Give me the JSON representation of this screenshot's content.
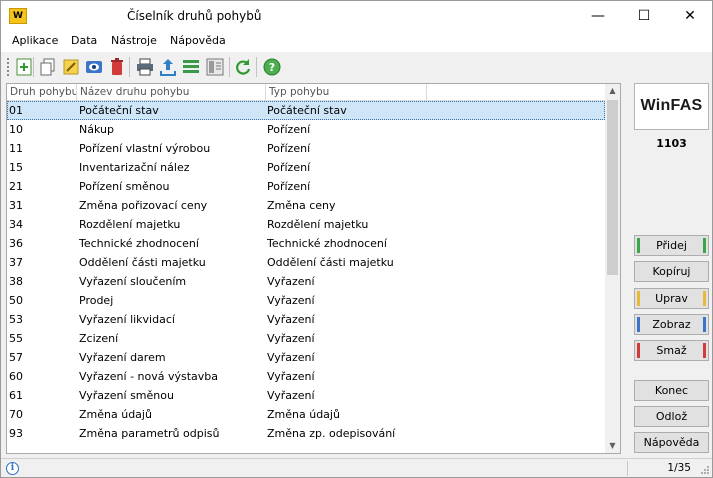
{
  "window": {
    "logo": "W",
    "title": "Číselník druhů pohybů",
    "minimize": "—",
    "maximize": "☐",
    "close": "✕"
  },
  "menu": [
    "Aplikace",
    "Data",
    "Nástroje",
    "Nápověda"
  ],
  "toolbar": {
    "buttons": [
      "add-icon",
      "copy-icon",
      "edit-icon",
      "view-icon",
      "delete-icon",
      "print-icon",
      "export-icon",
      "columns-icon",
      "layout-icon",
      "refresh-icon",
      "help-icon"
    ]
  },
  "grid": {
    "columns": [
      "Druh pohybu",
      "Název druhu pohybu",
      "Typ pohybu"
    ],
    "rows": [
      [
        "01",
        "Počáteční stav",
        "Počáteční stav"
      ],
      [
        "10",
        "Nákup",
        "Pořízení"
      ],
      [
        "11",
        "Pořízení vlastní výrobou",
        "Pořízení"
      ],
      [
        "15",
        "Inventarizační nález",
        "Pořízení"
      ],
      [
        "21",
        "Pořízení směnou",
        "Pořízení"
      ],
      [
        "31",
        "Změna pořizovací ceny",
        "Změna ceny"
      ],
      [
        "34",
        "Rozdělení majetku",
        "Rozdělení majetku"
      ],
      [
        "36",
        "Technické zhodnocení",
        "Technické zhodnocení"
      ],
      [
        "37",
        "Oddělení části majetku",
        "Oddělení části majetku"
      ],
      [
        "38",
        "Vyřazení sloučením",
        "Vyřazení"
      ],
      [
        "50",
        "Prodej",
        "Vyřazení"
      ],
      [
        "53",
        "Vyřazení likvidací",
        "Vyřazení"
      ],
      [
        "55",
        "Zcizení",
        "Vyřazení"
      ],
      [
        "57",
        "Vyřazení darem",
        "Vyřazení"
      ],
      [
        "60",
        "Vyřazení - nová výstavba",
        "Vyřazení"
      ],
      [
        "61",
        "Vyřazení směnou",
        "Vyřazení"
      ],
      [
        "70",
        "Změna údajů",
        "Změna údajů"
      ],
      [
        "93",
        "Změna parametrů odpisů",
        "Změna zp. odepisování"
      ]
    ],
    "selected_row": 0
  },
  "side": {
    "logo": "WinFAS",
    "company_code": "1103",
    "buttons": {
      "add": "Přidej",
      "copy": "Kopíruj",
      "edit": "Uprav",
      "view": "Zobraz",
      "delete": "Smaž",
      "end": "Konec",
      "send": "Odlož",
      "help": "Nápověda"
    },
    "colors": {
      "add": "#3aa64a",
      "edit": "#e8b93a",
      "view": "#3b74c9",
      "delete": "#d23b3b"
    }
  },
  "status": {
    "info": "i",
    "record_counter": "1/35"
  }
}
